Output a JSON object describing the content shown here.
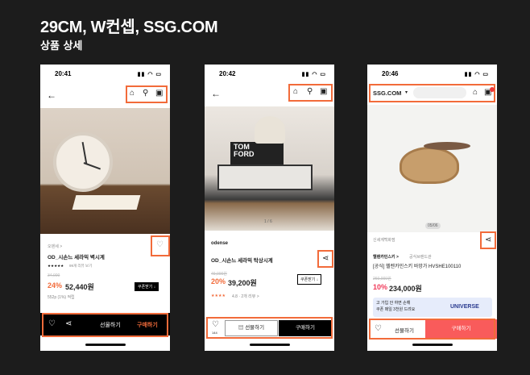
{
  "header": {
    "title": "29CM, W컨셉, SSG.COM",
    "subtitle": "상품 상세"
  },
  "phone1": {
    "time": "20:41",
    "brand": "오덴세 >",
    "product_name": "OD_시손느 세라믹 벽시계",
    "rating": "★★★★★",
    "review": "99개 리뷰 보기",
    "orig_price": "34,000",
    "discount": "24%",
    "price": "52,440원",
    "points": "552p (1%) 적립",
    "coupon_btn": "쿠폰받기 ↓",
    "gift": "선물하기",
    "buy": "구매하기"
  },
  "phone2": {
    "time": "20:42",
    "counter": "1 / 6",
    "brand": "odense",
    "product_name": "OD_시손느 세라믹 탁상시계",
    "orig_price": "49,000원",
    "discount": "20%",
    "price": "39,200원",
    "coupon_btn": "쿠폰받기 ↓",
    "rating": "★★★★",
    "review": "4.8 · 2개 리뷰 >",
    "like_count": "144",
    "gift": "선물하기",
    "buy": "구매하기"
  },
  "phone3": {
    "time": "20:46",
    "logo": "SSG.COM",
    "counter": "05/06",
    "store": "신세계백화점",
    "brand": "헬렌카민스키 >",
    "brand_tag": "공식브랜드관",
    "product_name": "[공식] 헬렌카민스키 바망가 HVSHE100110",
    "orig_price": "260,000원",
    "discount": "10%",
    "price": "234,000원",
    "banner_line1": "고 가입 안 하면 손해",
    "banner_line2": "쿠폰 매일 3천원 드려요",
    "banner_brand": "UNIVERSE",
    "gift": "선물하기",
    "buy": "구매하기"
  }
}
